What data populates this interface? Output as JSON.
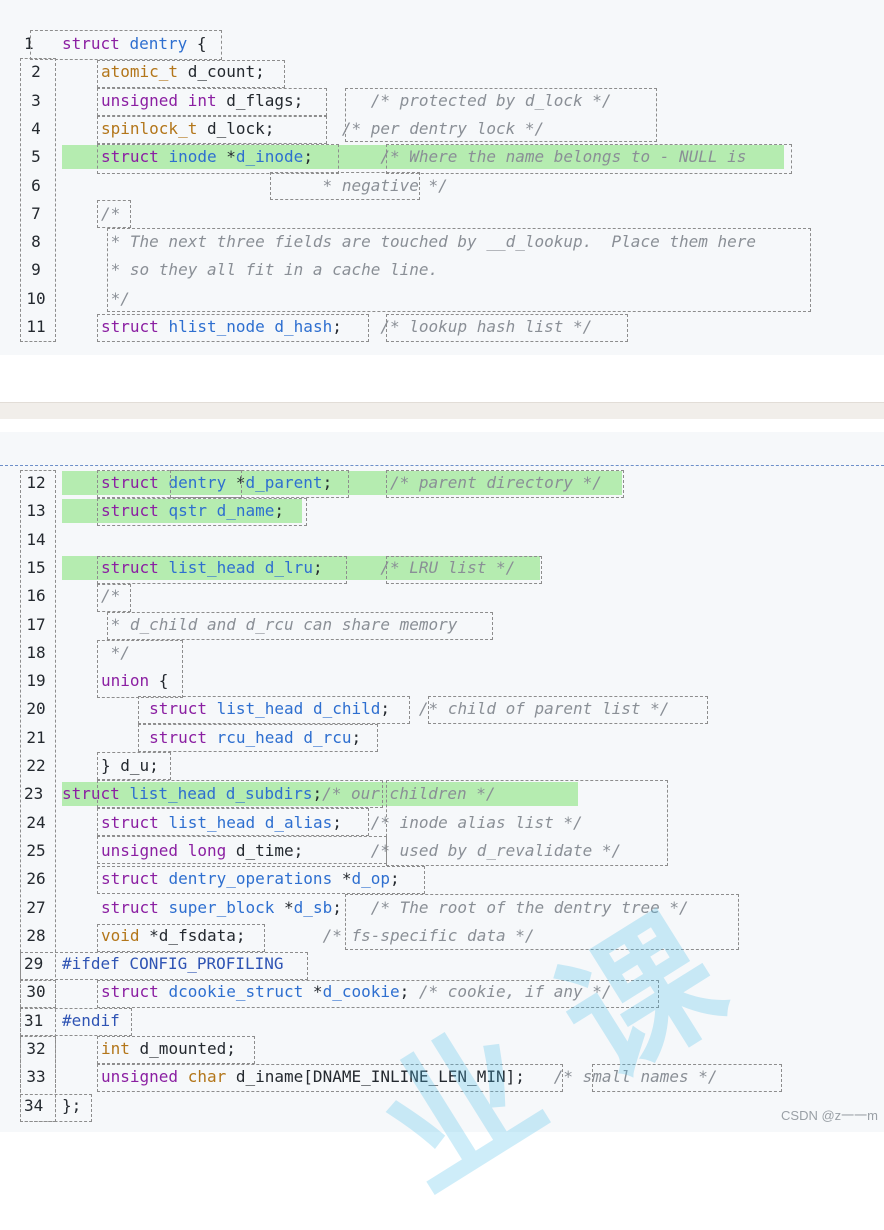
{
  "snippet_top": {
    "lines": [
      {
        "num": "1",
        "dir": true,
        "highlight": false,
        "tokens": [
          [
            "k",
            "struct "
          ],
          [
            "v",
            "dentry"
          ],
          [
            "p",
            " {"
          ]
        ]
      },
      {
        "num": "2",
        "dir": false,
        "highlight": false,
        "tokens": [
          [
            "t",
            "atomic_t"
          ],
          [
            "p",
            " d_count;"
          ]
        ]
      },
      {
        "num": "3",
        "dir": false,
        "highlight": false,
        "tokens": [
          [
            "k",
            "unsigned"
          ],
          [
            "p",
            " "
          ],
          [
            "k",
            "int"
          ],
          [
            "p",
            " d_flags;       "
          ],
          [
            "c",
            "/* protected by d_lock */"
          ]
        ]
      },
      {
        "num": "4",
        "dir": false,
        "highlight": false,
        "tokens": [
          [
            "t",
            "spinlock_t"
          ],
          [
            "p",
            " d_lock;       "
          ],
          [
            "c",
            "/* per dentry lock */"
          ]
        ]
      },
      {
        "num": "5",
        "dir": false,
        "highlight": true,
        "tokens": [
          [
            "k",
            "struct"
          ],
          [
            "p",
            " "
          ],
          [
            "v",
            "inode"
          ],
          [
            "p",
            " *"
          ],
          [
            "v",
            "d_inode"
          ],
          [
            "p",
            ";       "
          ],
          [
            "c",
            "/* Where the name belongs to - NULL is"
          ]
        ]
      },
      {
        "num": "6",
        "dir": false,
        "highlight": false,
        "tokens": [
          [
            "c",
            "                       * negative */"
          ]
        ]
      },
      {
        "num": "7",
        "dir": false,
        "highlight": false,
        "tokens": [
          [
            "c",
            "/*"
          ]
        ]
      },
      {
        "num": "8",
        "dir": false,
        "highlight": false,
        "tokens": [
          [
            "c",
            " * The next three fields are touched by __d_lookup.  Place them here"
          ]
        ]
      },
      {
        "num": "9",
        "dir": false,
        "highlight": false,
        "tokens": [
          [
            "c",
            " * so they all fit in a cache line."
          ]
        ]
      },
      {
        "num": "10",
        "dir": false,
        "highlight": false,
        "tokens": [
          [
            "c",
            " */"
          ]
        ]
      },
      {
        "num": "11",
        "dir": false,
        "highlight": false,
        "tokens": [
          [
            "k",
            "struct"
          ],
          [
            "p",
            " "
          ],
          [
            "v",
            "hlist_node"
          ],
          [
            "p",
            " "
          ],
          [
            "v",
            "d_hash"
          ],
          [
            "p",
            ";    "
          ],
          [
            "c",
            "/* lookup hash list */"
          ]
        ]
      }
    ]
  },
  "snippet_bottom": {
    "lines": [
      {
        "num": "12",
        "dir": false,
        "highlight": true,
        "tokens": [
          [
            "k",
            "struct"
          ],
          [
            "p",
            " "
          ],
          [
            "v",
            "dentry"
          ],
          [
            "p",
            " *"
          ],
          [
            "v",
            "d_parent"
          ],
          [
            "p",
            ";      "
          ],
          [
            "c",
            "/* parent directory */"
          ]
        ]
      },
      {
        "num": "13",
        "dir": false,
        "highlight": true,
        "tokens": [
          [
            "k",
            "struct"
          ],
          [
            "p",
            " "
          ],
          [
            "v",
            "qstr"
          ],
          [
            "p",
            " "
          ],
          [
            "v",
            "d_name"
          ],
          [
            "p",
            ";"
          ]
        ]
      },
      {
        "num": "14",
        "dir": false,
        "highlight": false,
        "tokens": []
      },
      {
        "num": "15",
        "dir": false,
        "highlight": true,
        "tokens": [
          [
            "k",
            "struct"
          ],
          [
            "p",
            " "
          ],
          [
            "v",
            "list_head"
          ],
          [
            "p",
            " "
          ],
          [
            "v",
            "d_lru"
          ],
          [
            "p",
            ";      "
          ],
          [
            "c",
            "/* LRU list */"
          ]
        ]
      },
      {
        "num": "16",
        "dir": false,
        "highlight": false,
        "tokens": [
          [
            "c",
            "/*"
          ]
        ]
      },
      {
        "num": "17",
        "dir": false,
        "highlight": false,
        "tokens": [
          [
            "c",
            " * d_child and d_rcu can share memory"
          ]
        ]
      },
      {
        "num": "18",
        "dir": false,
        "highlight": false,
        "tokens": [
          [
            "c",
            " */"
          ]
        ]
      },
      {
        "num": "19",
        "dir": false,
        "highlight": false,
        "tokens": [
          [
            "k",
            "union"
          ],
          [
            "p",
            " {"
          ]
        ]
      },
      {
        "num": "20",
        "dir": false,
        "highlight": false,
        "tokens": [
          [
            "p",
            "     "
          ],
          [
            "k",
            "struct"
          ],
          [
            "p",
            " "
          ],
          [
            "v",
            "list_head"
          ],
          [
            "p",
            " "
          ],
          [
            "v",
            "d_child"
          ],
          [
            "p",
            ";   "
          ],
          [
            "c",
            "/* child of parent list */"
          ]
        ]
      },
      {
        "num": "21",
        "dir": false,
        "highlight": false,
        "tokens": [
          [
            "p",
            "     "
          ],
          [
            "k",
            "struct"
          ],
          [
            "p",
            " "
          ],
          [
            "v",
            "rcu_head"
          ],
          [
            "p",
            " "
          ],
          [
            "v",
            "d_rcu"
          ],
          [
            "p",
            ";"
          ]
        ]
      },
      {
        "num": "22",
        "dir": false,
        "highlight": false,
        "tokens": [
          [
            "p",
            "} d_u;"
          ]
        ]
      },
      {
        "num": "23",
        "dir": true,
        "highlight": true,
        "tokens": [
          [
            "k",
            "struct"
          ],
          [
            "p",
            " "
          ],
          [
            "v",
            "list_head"
          ],
          [
            "p",
            " "
          ],
          [
            "v",
            "d_subdirs"
          ],
          [
            "p",
            ";"
          ],
          [
            "c",
            "/* our children */"
          ]
        ]
      },
      {
        "num": "24",
        "dir": false,
        "highlight": false,
        "tokens": [
          [
            "k",
            "struct"
          ],
          [
            "p",
            " "
          ],
          [
            "v",
            "list_head"
          ],
          [
            "p",
            " "
          ],
          [
            "v",
            "d_alias"
          ],
          [
            "p",
            ";   "
          ],
          [
            "c",
            "/* inode alias list */"
          ]
        ]
      },
      {
        "num": "25",
        "dir": false,
        "highlight": false,
        "tokens": [
          [
            "k",
            "unsigned"
          ],
          [
            "p",
            " "
          ],
          [
            "k",
            "long"
          ],
          [
            "p",
            " d_time;       "
          ],
          [
            "c",
            "/* used by d_revalidate */"
          ]
        ]
      },
      {
        "num": "26",
        "dir": false,
        "highlight": false,
        "tokens": [
          [
            "k",
            "struct"
          ],
          [
            "p",
            " "
          ],
          [
            "v",
            "dentry_operations"
          ],
          [
            "p",
            " *"
          ],
          [
            "v",
            "d_op"
          ],
          [
            "p",
            ";"
          ]
        ]
      },
      {
        "num": "27",
        "dir": false,
        "highlight": false,
        "tokens": [
          [
            "k",
            "struct"
          ],
          [
            "p",
            " "
          ],
          [
            "v",
            "super_block"
          ],
          [
            "p",
            " *"
          ],
          [
            "v",
            "d_sb"
          ],
          [
            "p",
            ";   "
          ],
          [
            "c",
            "/* The root of the dentry tree */"
          ]
        ]
      },
      {
        "num": "28",
        "dir": false,
        "highlight": false,
        "tokens": [
          [
            "t",
            "void"
          ],
          [
            "p",
            " *d_fsdata;        "
          ],
          [
            "c",
            "/* fs-specific data */"
          ]
        ]
      },
      {
        "num": "29",
        "dir": true,
        "highlight": false,
        "tokens": [
          [
            "pp",
            "#ifdef CONFIG_PROFILING"
          ]
        ]
      },
      {
        "num": "30",
        "dir": false,
        "highlight": false,
        "tokens": [
          [
            "k",
            "struct"
          ],
          [
            "p",
            " "
          ],
          [
            "v",
            "dcookie_struct"
          ],
          [
            "p",
            " *"
          ],
          [
            "v",
            "d_cookie"
          ],
          [
            "p",
            "; "
          ],
          [
            "c",
            "/* cookie, if any */"
          ]
        ]
      },
      {
        "num": "31",
        "dir": true,
        "highlight": false,
        "tokens": [
          [
            "pp",
            "#endif"
          ]
        ]
      },
      {
        "num": "32",
        "dir": false,
        "highlight": false,
        "tokens": [
          [
            "t",
            "int"
          ],
          [
            "p",
            " d_mounted;"
          ]
        ]
      },
      {
        "num": "33",
        "dir": false,
        "highlight": false,
        "tokens": [
          [
            "k",
            "unsigned"
          ],
          [
            "p",
            " "
          ],
          [
            "t",
            "char"
          ],
          [
            "p",
            " d_iname[DNAME_INLINE_LEN_MIN];   "
          ],
          [
            "c",
            "/* small names */"
          ]
        ]
      },
      {
        "num": "34",
        "dir": true,
        "highlight": false,
        "tokens": [
          [
            "p",
            "};"
          ]
        ]
      }
    ]
  },
  "watermark": {
    "glyph_1": "课",
    "glyph_2": "业"
  },
  "credit": "CSDN @z一一m"
}
